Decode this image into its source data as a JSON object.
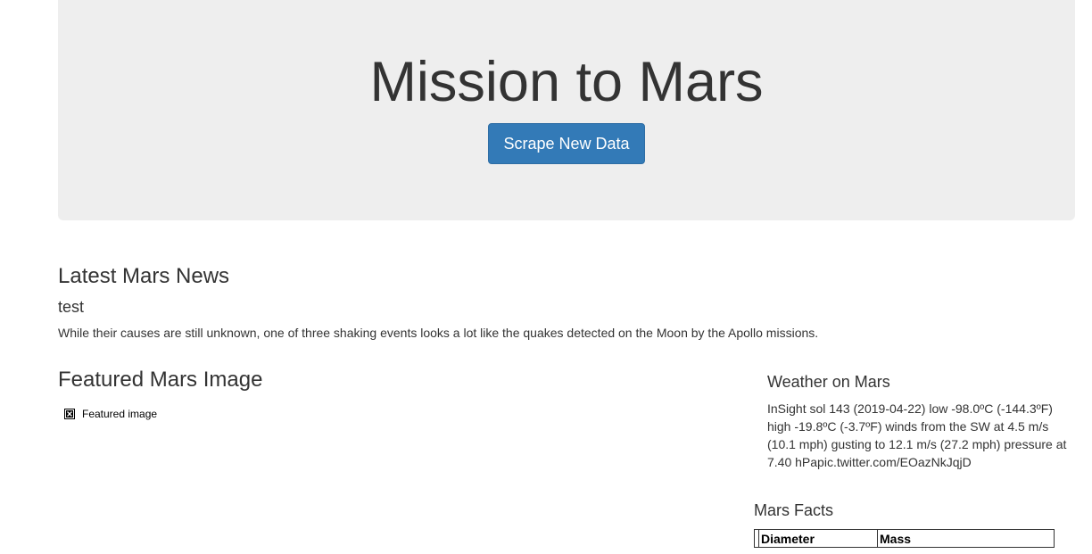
{
  "header": {
    "title": "Mission to Mars",
    "scrape_button_label": "Scrape New Data"
  },
  "news": {
    "heading": "Latest Mars News",
    "title": "test",
    "teaser": "While their causes are still unknown, one of three shaking events looks a lot like the quakes detected on the Moon by the Apollo missions."
  },
  "featured": {
    "heading": "Featured Mars Image",
    "image_alt": "Featured image",
    "icon": "broken-image-icon"
  },
  "weather": {
    "heading": "Weather on Mars",
    "text": "InSight sol 143 (2019-04-22) low -98.0ºC (-144.3ºF) high -19.8ºC (-3.7ºF) winds from the SW at 4.5 m/s (10.1 mph) gusting to 12.1 m/s (27.2 mph) pressure at 7.40 hPapic.twitter.com/EOazNkJqjD"
  },
  "facts": {
    "heading": "Mars Facts",
    "columns": [
      "",
      "Diameter",
      "Mass"
    ]
  },
  "colors": {
    "jumbotron_bg": "#eeeeee",
    "primary_button": "#337ab7",
    "text": "#333333"
  }
}
